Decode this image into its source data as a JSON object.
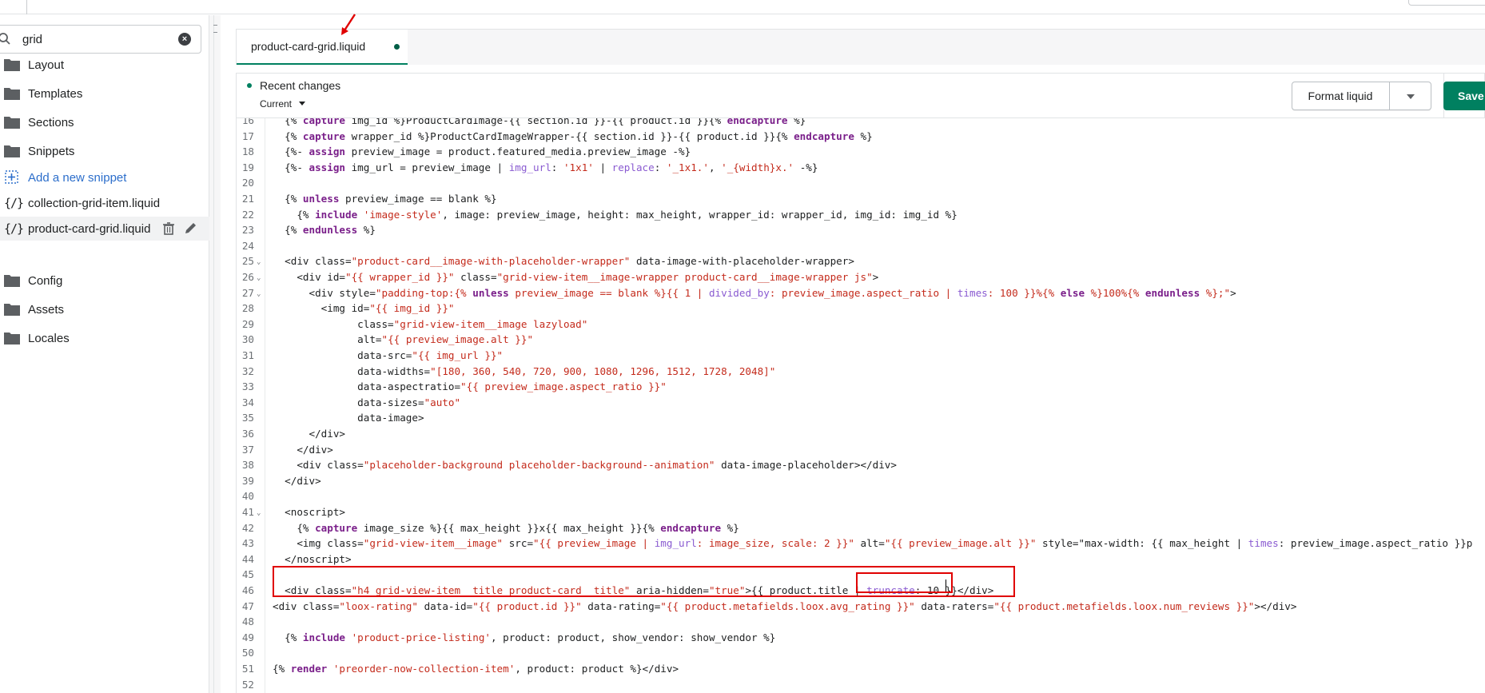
{
  "sidebar": {
    "search_value": "grid",
    "items": [
      {
        "label": "Layout",
        "icon": "folder-icon"
      },
      {
        "label": "Templates",
        "icon": "folder-icon"
      },
      {
        "label": "Sections",
        "icon": "folder-icon"
      },
      {
        "label": "Snippets",
        "icon": "folder-icon"
      },
      {
        "label": "Add a new snippet",
        "icon": "add-file-icon"
      },
      {
        "label": "collection-grid-item.liquid",
        "icon": "liquid-file-icon"
      },
      {
        "label": "product-card-grid.liquid",
        "icon": "liquid-file-icon"
      },
      {
        "label": "Config",
        "icon": "folder-icon"
      },
      {
        "label": "Assets",
        "icon": "folder-icon"
      },
      {
        "label": "Locales",
        "icon": "folder-icon"
      }
    ]
  },
  "tab": {
    "label": "product-card-grid.liquid",
    "unsaved_dot_color": "#005e46"
  },
  "toolbar": {
    "recent_title": "Recent changes",
    "current_label": "Current",
    "format_label": "Format liquid",
    "save_label": "Save"
  },
  "colors": {
    "accent": "#008060",
    "highlight": "#e00000",
    "link": "#2c6ecb"
  },
  "code": {
    "lines": [
      {
        "n": "16",
        "text": "  {% capture img_id %}ProductCardImage-{{ section.id }}-{{ product.id }}{% endcapture %}"
      },
      {
        "n": "17",
        "text": "  {% capture wrapper_id %}ProductCardImageWrapper-{{ section.id }}-{{ product.id }}{% endcapture %}"
      },
      {
        "n": "18",
        "text": "  {%- assign preview_image = product.featured_media.preview_image -%}"
      },
      {
        "n": "19",
        "text": "  {%- assign img_url = preview_image | img_url: '1x1' | replace: '_1x1.', '_{width}x.' -%}"
      },
      {
        "n": "20",
        "text": ""
      },
      {
        "n": "21",
        "text": "  {% unless preview_image == blank %}"
      },
      {
        "n": "22",
        "text": "    {% include 'image-style', image: preview_image, height: max_height, wrapper_id: wrapper_id, img_id: img_id %}"
      },
      {
        "n": "23",
        "text": "  {% endunless %}"
      },
      {
        "n": "24",
        "text": ""
      },
      {
        "n": "25",
        "text": "  <div class=\"product-card__image-with-placeholder-wrapper\" data-image-with-placeholder-wrapper>"
      },
      {
        "n": "26",
        "text": "    <div id=\"{{ wrapper_id }}\" class=\"grid-view-item__image-wrapper product-card__image-wrapper js\">"
      },
      {
        "n": "27",
        "text": "      <div style=\"padding-top:{% unless preview_image == blank %}{{ 1 | divided_by: preview_image.aspect_ratio | times: 100 }}%{% else %}100%{% endunless %};\">"
      },
      {
        "n": "28",
        "text": "        <img id=\"{{ img_id }}\""
      },
      {
        "n": "29",
        "text": "              class=\"grid-view-item__image lazyload\""
      },
      {
        "n": "30",
        "text": "              alt=\"{{ preview_image.alt }}\""
      },
      {
        "n": "31",
        "text": "              data-src=\"{{ img_url }}\""
      },
      {
        "n": "32",
        "text": "              data-widths=\"[180, 360, 540, 720, 900, 1080, 1296, 1512, 1728, 2048]\""
      },
      {
        "n": "33",
        "text": "              data-aspectratio=\"{{ preview_image.aspect_ratio }}\""
      },
      {
        "n": "34",
        "text": "              data-sizes=\"auto\""
      },
      {
        "n": "35",
        "text": "              data-image>"
      },
      {
        "n": "36",
        "text": "      </div>"
      },
      {
        "n": "37",
        "text": "    </div>"
      },
      {
        "n": "38",
        "text": "    <div class=\"placeholder-background placeholder-background--animation\" data-image-placeholder></div>"
      },
      {
        "n": "39",
        "text": "  </div>"
      },
      {
        "n": "40",
        "text": ""
      },
      {
        "n": "41",
        "text": "  <noscript>"
      },
      {
        "n": "42",
        "text": "    {% capture image_size %}{{ max_height }}x{{ max_height }}{% endcapture %}"
      },
      {
        "n": "43",
        "text": "    <img class=\"grid-view-item__image\" src=\"{{ preview_image | img_url: image_size, scale: 2 }}\" alt=\"{{ preview_image.alt }}\" style=\"max-width: {{ max_height | times: preview_image.aspect_ratio }}p"
      },
      {
        "n": "44",
        "text": "  </noscript>"
      },
      {
        "n": "45",
        "text": ""
      },
      {
        "n": "46",
        "text": "  <div class=\"h4 grid-view-item__title product-card__title\" aria-hidden=\"true\">{{ product.title | truncate: 10 }}</div>"
      },
      {
        "n": "47",
        "text": "<div class=\"loox-rating\" data-id=\"{{ product.id }}\" data-rating=\"{{ product.metafields.loox.avg_rating }}\" data-raters=\"{{ product.metafields.loox.num_reviews }}\"></div>"
      },
      {
        "n": "48",
        "text": ""
      },
      {
        "n": "49",
        "text": "  {% include 'product-price-listing', product: product, show_vendor: show_vendor %}"
      },
      {
        "n": "50",
        "text": ""
      },
      {
        "n": "51",
        "text": "{% render 'preorder-now-collection-item', product: product %}</div>"
      },
      {
        "n": "52",
        "text": ""
      }
    ]
  }
}
